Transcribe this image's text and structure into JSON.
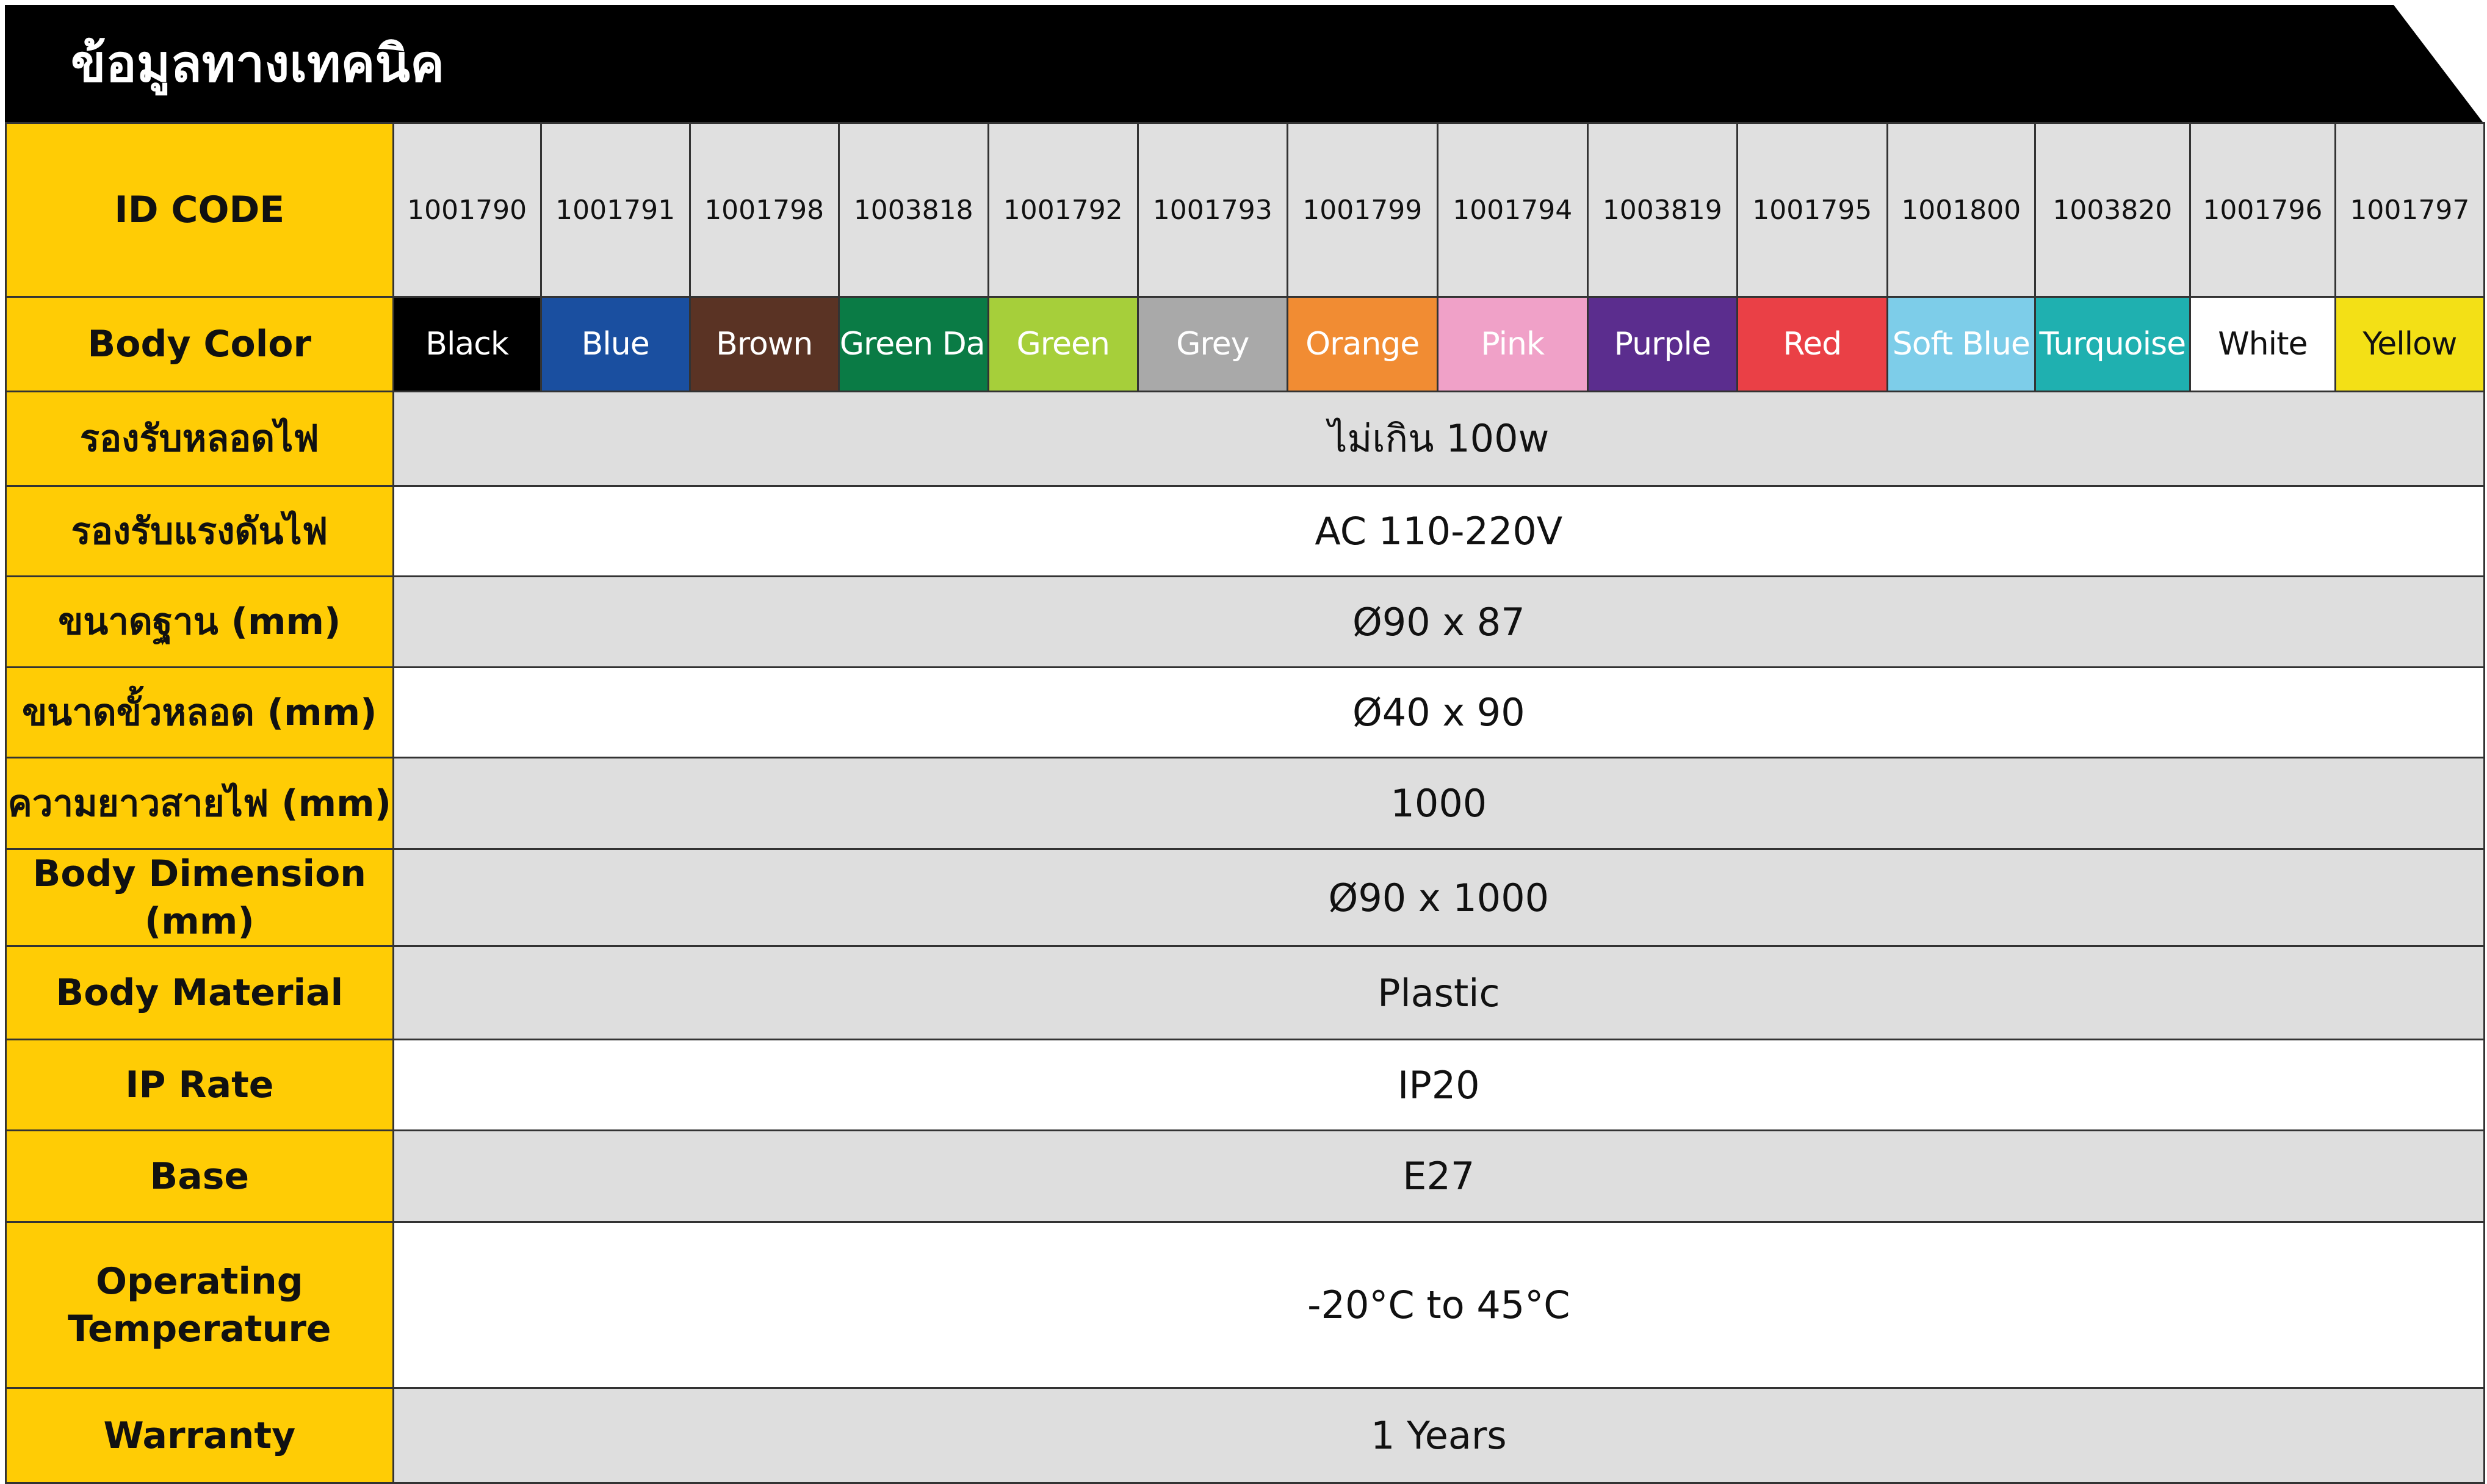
{
  "header": {
    "title": "ข้อมูลทางเทคนิค"
  },
  "labels": {
    "id_code": "ID CODE",
    "body_color": "Body Color",
    "bulb_support": "รองรับหลอดไฟ",
    "voltage": "รองรับแรงดันไฟ",
    "base_size": "ขนาดฐาน (mm)",
    "socket_size": "ขนาดขั้วหลอด (mm)",
    "cable_length": "ความยาวสายไฟ (mm)",
    "body_dimension": "Body Dimension (mm)",
    "body_material": "Body Material",
    "ip_rate": "IP Rate",
    "base": "Base",
    "operating_temp_line1": "Operating",
    "operating_temp_line2": "Temperature",
    "warranty": "Warranty"
  },
  "codes": [
    "1001790",
    "1001791",
    "1001798",
    "1003818",
    "1001792",
    "1001793",
    "1001799",
    "1001794",
    "1003819",
    "1001795",
    "1001800",
    "1003820",
    "1001796",
    "1001797"
  ],
  "colors": [
    {
      "name": "Black",
      "bg": "#000000",
      "fg": "#ffffff"
    },
    {
      "name": "Blue",
      "bg": "#1a4fa0",
      "fg": "#ffffff"
    },
    {
      "name": "Brown",
      "bg": "#5a3324",
      "fg": "#ffffff"
    },
    {
      "name": "Green Dark",
      "bg": "#0a7b45",
      "fg": "#ffffff"
    },
    {
      "name": "Green",
      "bg": "#a6cf3a",
      "fg": "#ffffff"
    },
    {
      "name": "Grey",
      "bg": "#a9a9a9",
      "fg": "#ffffff"
    },
    {
      "name": "Orange",
      "bg": "#f18c33",
      "fg": "#ffffff"
    },
    {
      "name": "Pink",
      "bg": "#f0a1c8",
      "fg": "#ffffff"
    },
    {
      "name": "Purple",
      "bg": "#5b2d8e",
      "fg": "#ffffff"
    },
    {
      "name": "Red",
      "bg": "#ea4046",
      "fg": "#ffffff"
    },
    {
      "name": "Soft Blue",
      "bg": "#7dcde9",
      "fg": "#ffffff"
    },
    {
      "name": "Turquoise",
      "bg": "#1fb0b0",
      "fg": "#ffffff"
    },
    {
      "name": "White",
      "bg": "#ffffff",
      "fg": "#111111"
    },
    {
      "name": "Yellow",
      "bg": "#f3e016",
      "fg": "#111111"
    }
  ],
  "values": {
    "bulb_support": "ไม่เกิน 100w",
    "voltage": "AC 110-220V",
    "base_size": "Ø90 x 87",
    "socket_size": "Ø40 x 90",
    "cable_length": "1000",
    "body_dimension": "Ø90 x 1000",
    "body_material": "Plastic",
    "ip_rate": "IP20",
    "base": "E27",
    "operating_temp": "-20°C to 45°C",
    "warranty": "1 Years"
  },
  "theme": {
    "label_bg": "#ffcc05",
    "header_bg": "#000000",
    "gray_row": "#dedede"
  }
}
